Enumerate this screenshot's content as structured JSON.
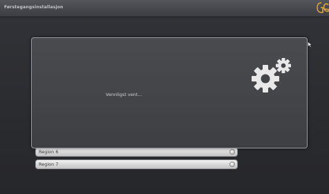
{
  "window": {
    "title": "Førstegangsinstallasjon"
  },
  "brand": {
    "icon": "brand-logo-icon"
  },
  "dialog": {
    "message": "Vennligst vent...",
    "icon": "gears-icon"
  },
  "list": {
    "items": [
      {
        "label": ""
      },
      {
        "label": "Region 6"
      },
      {
        "label": "Region 7"
      }
    ]
  },
  "colors": {
    "background": "#2e2f33",
    "titlebar": "#45464b",
    "dialog": "#434448",
    "list_row": "#d9d9d9",
    "brand_accent": "#e2a93a"
  }
}
